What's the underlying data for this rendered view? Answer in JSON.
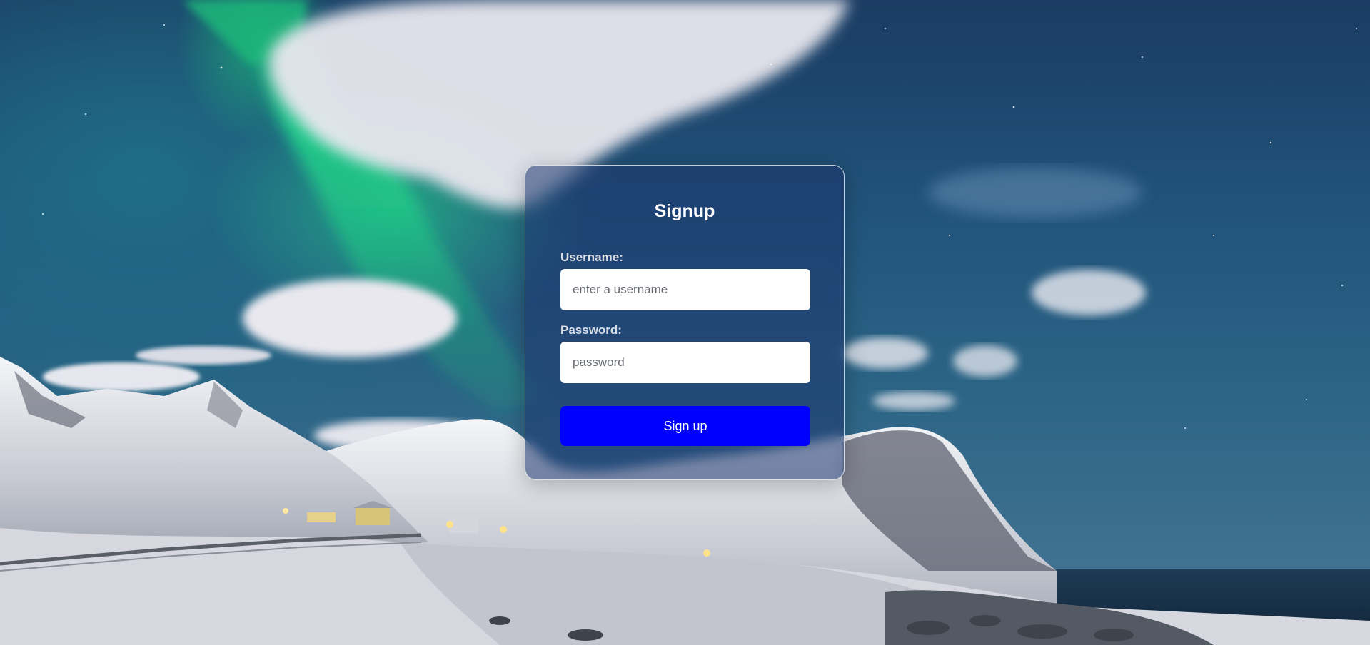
{
  "form": {
    "title": "Signup",
    "username": {
      "label": "Username:",
      "placeholder": "enter a username",
      "value": ""
    },
    "password": {
      "label": "Password:",
      "placeholder": "password",
      "value": ""
    },
    "submit_label": "Sign up"
  },
  "colors": {
    "button": "#0000ff",
    "aurora": "#2ad88a",
    "sky": "#1f4e78"
  }
}
